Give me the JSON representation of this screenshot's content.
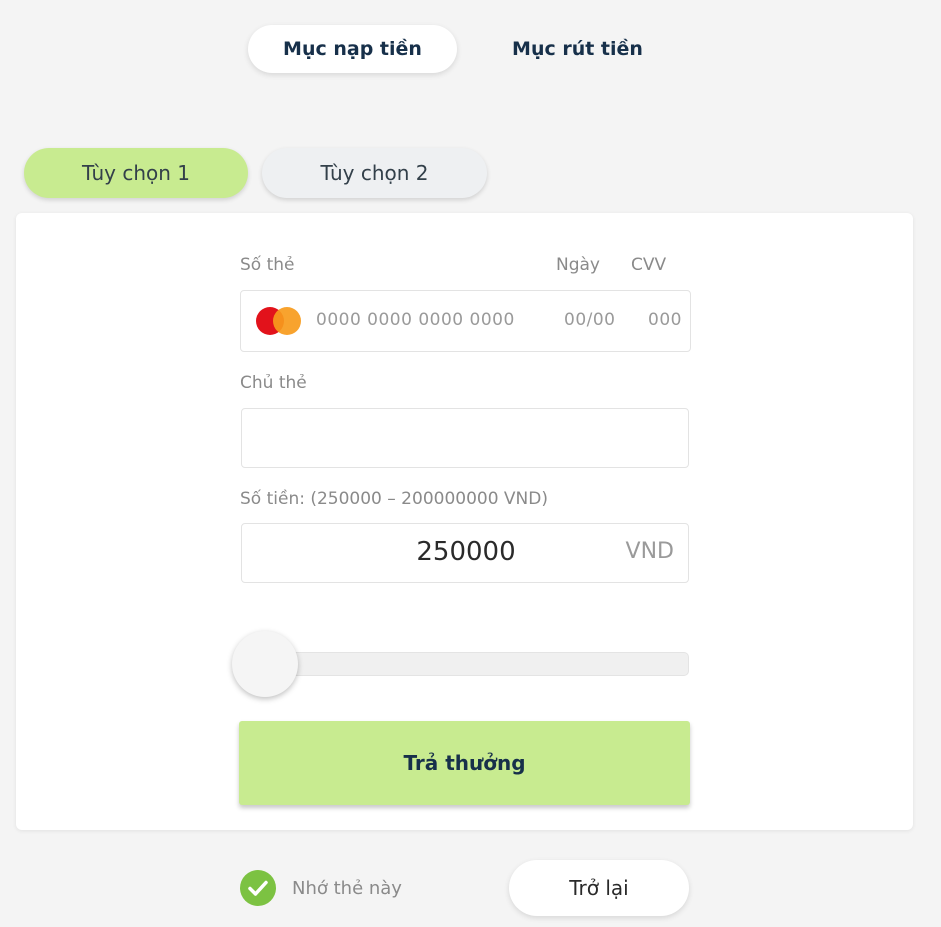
{
  "tabs": {
    "deposit_label": "Mục nạp tiền",
    "withdraw_label": "Mục rút tiền"
  },
  "options": {
    "option1_label": "Tùy chọn 1",
    "option2_label": "Tùy chọn 2"
  },
  "form": {
    "card_number_label": "Số thẻ",
    "date_label": "Ngày",
    "cvv_label": "CVV",
    "card_number_placeholder": "0000 0000 0000 0000",
    "date_placeholder": "00/00",
    "cvv_placeholder": "000",
    "card_holder_label": "Chủ thẻ",
    "card_holder_value": "",
    "amount_label": "Số tiền: (250000 – 200000000 VND)",
    "amount_value": "250000",
    "amount_unit": "VND",
    "submit_label": "Trả thưởng"
  },
  "slider": {
    "min": 250000,
    "max": 200000000,
    "value": 250000
  },
  "footer": {
    "remember_label": "Nhớ thẻ này",
    "remember_checked": true,
    "back_label": "Trở lại"
  },
  "colors": {
    "accent_green": "#c8eb90",
    "check_green": "#7cc242",
    "heading_navy": "#17304a",
    "mastercard_red": "#e2121b",
    "mastercard_orange": "#f79b1c"
  },
  "icons": {
    "card_brand": "mastercard-icon",
    "remember": "checkmark-icon"
  }
}
